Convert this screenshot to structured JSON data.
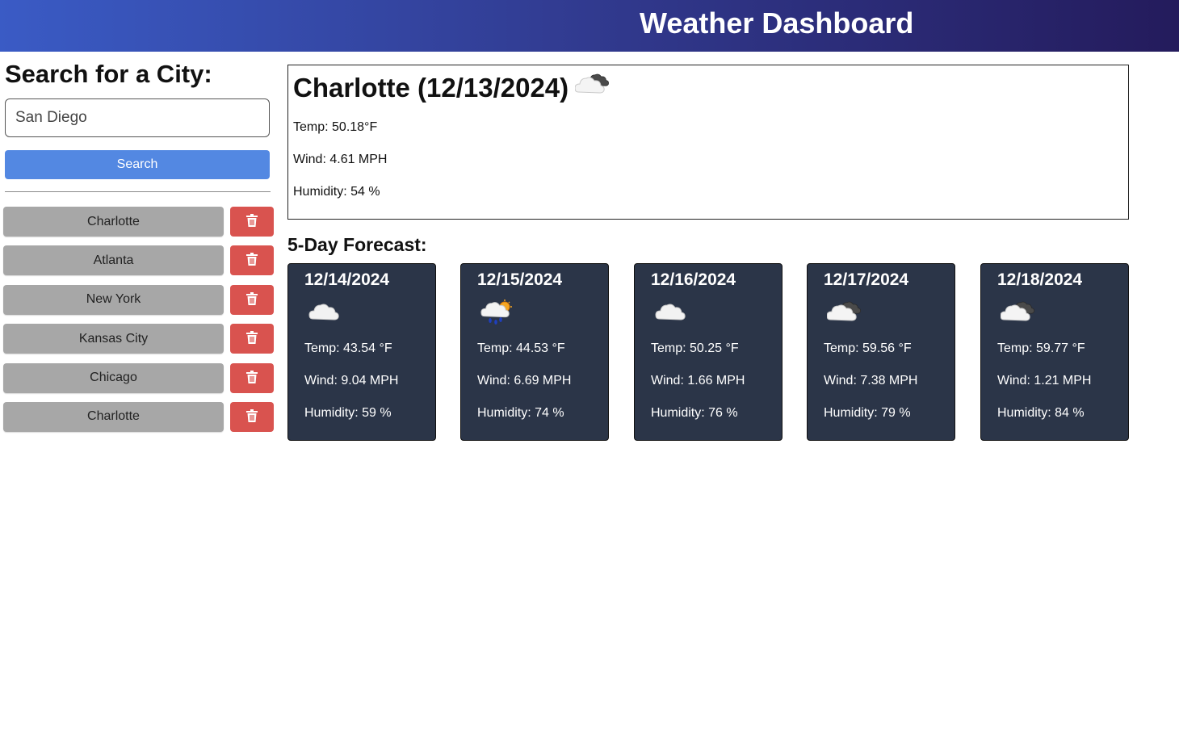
{
  "header": {
    "title": "Weather Dashboard"
  },
  "search": {
    "title": "Search for a City:",
    "input_value": "San Diego",
    "button_label": "Search"
  },
  "history": [
    {
      "city": "Charlotte"
    },
    {
      "city": "Atlanta"
    },
    {
      "city": "New York"
    },
    {
      "city": "Kansas City"
    },
    {
      "city": "Chicago"
    },
    {
      "city": "Charlotte"
    }
  ],
  "current": {
    "title": "Charlotte (12/13/2024)",
    "icon": "broken-clouds-icon",
    "temp": "Temp: 50.18°F",
    "wind": "Wind: 4.61 MPH",
    "humidity": "Humidity: 54 %"
  },
  "forecast": {
    "title": "5-Day Forecast:",
    "days": [
      {
        "date": "12/14/2024",
        "icon": "cloud-icon",
        "temp": "Temp: 43.54 °F",
        "wind": "Wind: 9.04 MPH",
        "humidity": "Humidity: 59 %"
      },
      {
        "date": "12/15/2024",
        "icon": "rain-sun-icon",
        "temp": "Temp: 44.53 °F",
        "wind": "Wind: 6.69 MPH",
        "humidity": "Humidity: 74 %"
      },
      {
        "date": "12/16/2024",
        "icon": "cloud-icon",
        "temp": "Temp: 50.25 °F",
        "wind": "Wind: 1.66 MPH",
        "humidity": "Humidity: 76 %"
      },
      {
        "date": "12/17/2024",
        "icon": "broken-clouds-icon",
        "temp": "Temp: 59.56 °F",
        "wind": "Wind: 7.38 MPH",
        "humidity": "Humidity: 79 %"
      },
      {
        "date": "12/18/2024",
        "icon": "broken-clouds-icon",
        "temp": "Temp: 59.77 °F",
        "wind": "Wind: 1.21 MPH",
        "humidity": "Humidity: 84 %"
      }
    ]
  },
  "colors": {
    "search_button": "#5388e2",
    "delete_button": "#d9534f",
    "history_button": "#a7a7a7",
    "forecast_card": "#2b3548"
  }
}
